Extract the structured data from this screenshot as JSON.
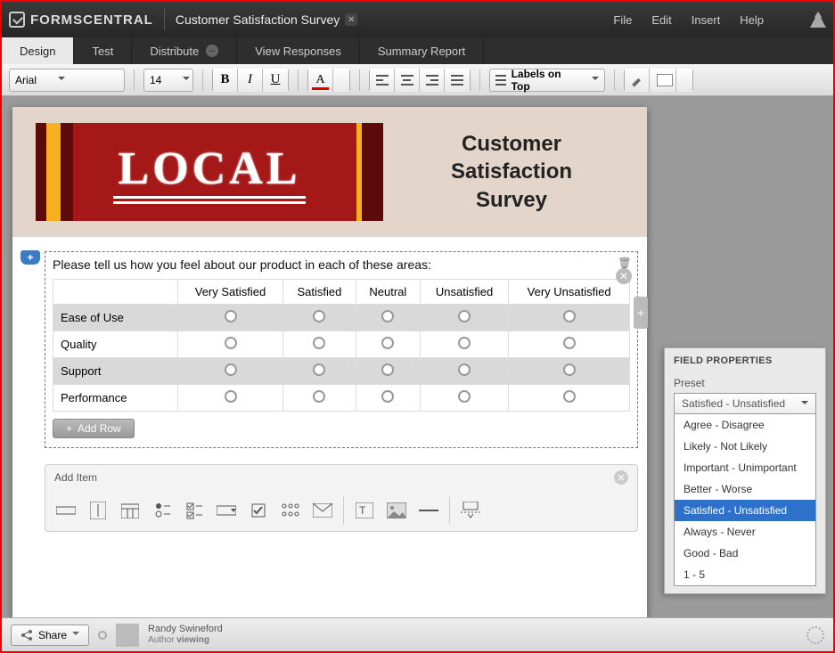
{
  "app_name": "FORMSCENTRAL",
  "doc_title": "Customer Satisfaction Survey",
  "menu": {
    "file": "File",
    "edit": "Edit",
    "insert": "Insert",
    "help": "Help"
  },
  "tabs": {
    "design": "Design",
    "test": "Test",
    "distribute": "Distribute",
    "view_responses": "View Responses",
    "summary": "Summary Report"
  },
  "toolbar": {
    "font": "Arial",
    "size": "14",
    "labels_on_top": "Labels on Top"
  },
  "form": {
    "banner_word": "LOCAL",
    "title_line1": "Customer",
    "title_line2": "Satisfaction",
    "title_line3": "Survey",
    "question": "Please tell us how you feel about our product in each of these areas:",
    "columns": [
      "Very Satisfied",
      "Satisfied",
      "Neutral",
      "Unsatisfied",
      "Very Unsatisfied"
    ],
    "rows": [
      "Ease of Use",
      "Quality",
      "Support",
      "Performance"
    ],
    "add_row": "Add Row",
    "add_item": "Add Item"
  },
  "props": {
    "title": "FIELD PROPERTIES",
    "preset_label": "Preset",
    "preset_value": "Satisfied - Unsatisfied",
    "options": [
      "Agree - Disagree",
      "Likely - Not Likely",
      "Important - Unimportant",
      "Better - Worse",
      "Satisfied - Unsatisfied",
      "Always - Never",
      "Good - Bad",
      "1 - 5"
    ]
  },
  "footer": {
    "share": "Share",
    "author_name": "Randy Swineford",
    "author_role": "Author",
    "author_status": "viewing"
  }
}
